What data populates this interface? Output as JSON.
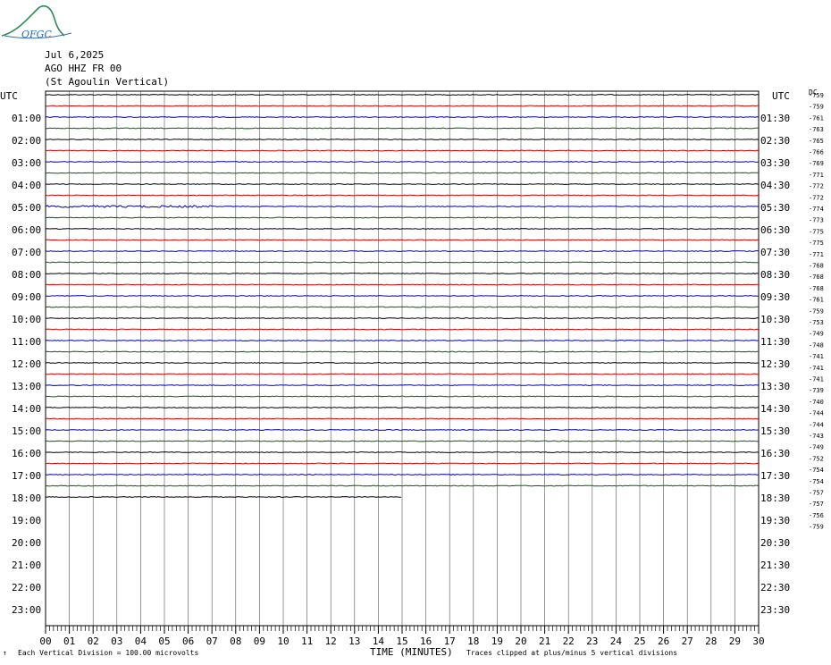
{
  "header": {
    "logo_text": "OFGC",
    "date": "Jul 6,2025",
    "station": "AGO HHZ FR 00",
    "location": "(St Agoulin Vertical)"
  },
  "footer": {
    "division_note": "Each Vertical Division = 100.00 microvolts",
    "clip_note": "Traces clipped at plus/minus 5 vertical divisions",
    "corner_mark": "↑"
  },
  "chart_data": {
    "type": "line",
    "title": "",
    "xlabel": "TIME (MINUTES)",
    "ylabel": "UTC",
    "right_ylabel": "UTC",
    "dc_label": "DC",
    "xlim": [
      0,
      30
    ],
    "x_ticks": [
      "00",
      "01",
      "02",
      "03",
      "04",
      "05",
      "06",
      "07",
      "08",
      "09",
      "10",
      "11",
      "12",
      "13",
      "14",
      "15",
      "16",
      "17",
      "18",
      "19",
      "20",
      "21",
      "22",
      "23",
      "24",
      "25",
      "26",
      "27",
      "28",
      "29",
      "30"
    ],
    "left_hour_labels": [
      "01:00",
      "02:00",
      "03:00",
      "04:00",
      "05:00",
      "06:00",
      "07:00",
      "08:00",
      "09:00",
      "10:00",
      "11:00",
      "12:00",
      "13:00",
      "14:00",
      "15:00",
      "16:00",
      "17:00",
      "18:00",
      "19:00",
      "20:00",
      "21:00",
      "22:00",
      "23:00"
    ],
    "right_hour_labels": [
      "01:30",
      "02:30",
      "03:30",
      "04:30",
      "05:30",
      "06:30",
      "07:30",
      "08:30",
      "09:30",
      "10:30",
      "11:30",
      "12:30",
      "13:30",
      "14:30",
      "15:30",
      "16:30",
      "17:30",
      "18:30",
      "19:30",
      "20:30",
      "21:30",
      "22:30",
      "23:30"
    ],
    "trace_colors": [
      "#000000",
      "#cc0000",
      "#0000aa",
      "#006600"
    ],
    "traces_per_hour": 2,
    "trace_minutes": 30,
    "total_traces": 48,
    "traces_recorded": 37,
    "last_trace_end_minute": 15,
    "dc_offsets": [
      -759,
      -759,
      -761,
      -763,
      -765,
      -766,
      -769,
      -771,
      -772,
      -772,
      -774,
      -773,
      -775,
      -775,
      -771,
      -768,
      -768,
      -768,
      -761,
      -759,
      -753,
      -749,
      -748,
      -741,
      -741,
      -741,
      -739,
      -740,
      -744,
      -744,
      -743,
      -749,
      -752,
      -754,
      -754,
      -757,
      -757,
      -756,
      -759
    ],
    "notable_events": [
      {
        "trace": 10,
        "minute_from": 0,
        "minute_to": 7,
        "note": "elevated noise"
      }
    ]
  }
}
